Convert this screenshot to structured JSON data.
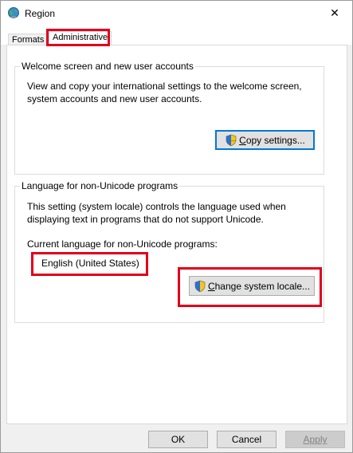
{
  "window": {
    "title": "Region",
    "close_glyph": "✕"
  },
  "tabs": [
    {
      "label": "Formats",
      "selected": false
    },
    {
      "label": "Administrative",
      "selected": true
    }
  ],
  "welcome_group": {
    "title": "Welcome screen and new user accounts",
    "description_line1": "View and copy your international settings to the welcome screen,",
    "description_line2": "system accounts and new user accounts.",
    "button_mnemonic": "C",
    "button_rest": "opy settings...",
    "button_icon": "uac-shield-icon"
  },
  "locale_group": {
    "title": "Language for non-Unicode programs",
    "description_line1": "This setting (system locale) controls the language used when",
    "description_line2": "displaying text in programs that do not support Unicode.",
    "current_label": "Current language for non-Unicode programs:",
    "current_value": "English (United States)",
    "button_mnemonic": "C",
    "button_rest": "hange system locale...",
    "button_icon": "uac-shield-icon"
  },
  "footer": {
    "ok_label": "OK",
    "cancel_label": "Cancel",
    "apply_label": "Apply",
    "apply_enabled": false
  },
  "colors": {
    "highlight_red": "#e0001b",
    "focus_blue": "#0078d7",
    "dialog_bg": "#f0f0f0"
  }
}
